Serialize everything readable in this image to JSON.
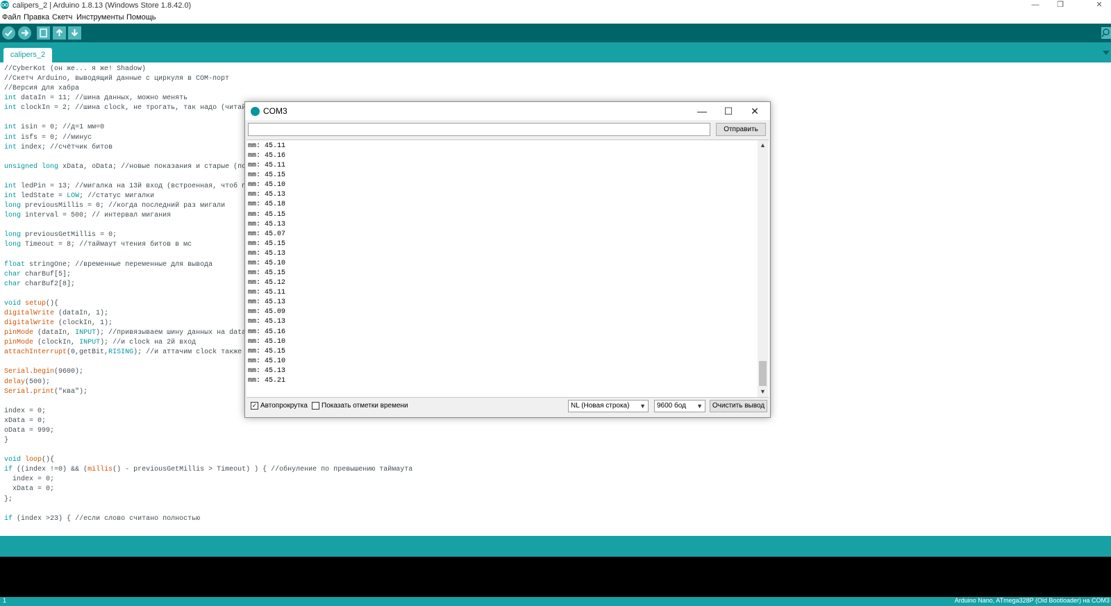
{
  "window": {
    "title": "calipers_2 | Arduino 1.8.13 (Windows Store 1.8.42.0)",
    "controls": [
      "—",
      "❐",
      "✕"
    ]
  },
  "menu": [
    "Файл",
    "Правка",
    "Скетч",
    "Инструменты",
    "Помощь"
  ],
  "toolbar": {
    "buttons": [
      "verify-icon",
      "upload-icon",
      "new-icon",
      "open-icon",
      "save-icon"
    ],
    "serial_monitor_icon": "magnifier-icon"
  },
  "tab": {
    "label": "calipers_2",
    "menu_icon": "chevron-down-icon"
  },
  "code": [
    "//CyberKot (он же... я же! Shadow)",
    "//Скетч Arduino, выводящий данные с циркуля в COM-порт",
    "//Версия для хабра",
    "int dataIn = 11; //шина данных, можно менять",
    "int clockIn = 2; //шина clock, не трогать, так надо (читай",
    "",
    "int isin = 0; //д=1 мм=0",
    "int isfs = 0; //минус",
    "int index; //счётчик битов",
    "",
    "unsigned long xData, oData; //новые показания и старые (пот",
    "",
    "int ledPin = 13; //мигалка на 13й вход (встроенная, чтоб по",
    "int ledState = LOW; //статус мигалки",
    "long previousMillis = 0; //когда последний раз мигали",
    "long interval = 500; // интервал мигания",
    "",
    "long previousGetMillis = 0;",
    "long Timeout = 8; //таймаут чтения битов в мс",
    "",
    "float stringOne; //временные переменные для вывода",
    "char charBuf[5];",
    "char charBuf2[8];",
    "",
    "void setup(){",
    "digitalWrite (dataIn, 1);",
    "digitalWrite (clockIn, 1);",
    "pinMode (dataIn, INPUT); //привязываем шину данных на data",
    "pinMode (clockIn, INPUT); //и clock на 2й вход",
    "attachInterrupt(0,getBit,RISING); //и аттачим clock также н",
    "",
    "Serial.begin(9600);",
    "delay(500);",
    "Serial.print(\"ква\");",
    "",
    "index = 0;",
    "xData = 0;",
    "oData = 999;",
    "}",
    "",
    "void loop(){",
    "if ((index !=0) && (millis() - previousGetMillis > Timeout) ) { //обнуление по превышению таймаута",
    "  index = 0;",
    "  xData = 0;",
    "};",
    "",
    "if (index >23) { //если слово считано полностью"
  ],
  "status": {
    "line_number": "1",
    "board": "Arduino Nano, ATmega328P (Old Bootloader) на COM3"
  },
  "serial_monitor": {
    "title": "COM3",
    "controls": [
      "—",
      "☐",
      "✕"
    ],
    "send_label": "Отправить",
    "input_value": "",
    "output": [
      "mm: 45.11",
      "mm: 45.16",
      "mm: 45.11",
      "mm: 45.15",
      "mm: 45.10",
      "mm: 45.13",
      "mm: 45.18",
      "mm: 45.15",
      "mm: 45.13",
      "mm: 45.07",
      "mm: 45.15",
      "mm: 45.13",
      "mm: 45.10",
      "mm: 45.15",
      "mm: 45.12",
      "mm: 45.11",
      "mm: 45.13",
      "mm: 45.09",
      "mm: 45.13",
      "mm: 45.16",
      "mm: 45.10",
      "mm: 45.15",
      "mm: 45.10",
      "mm: 45.13",
      "mm: 45.21"
    ],
    "autoscroll": {
      "label": "Автопрокрутка",
      "checked": true
    },
    "timestamps": {
      "label": "Показать отметки времени",
      "checked": false
    },
    "line_ending": "NL (Новая строка)",
    "baud": "9600 бод",
    "clear_label": "Очистить вывод"
  },
  "colors": {
    "toolbar": "#006468",
    "tabbar": "#17a1a5",
    "keyword": "#00979c",
    "function": "#d35400"
  }
}
